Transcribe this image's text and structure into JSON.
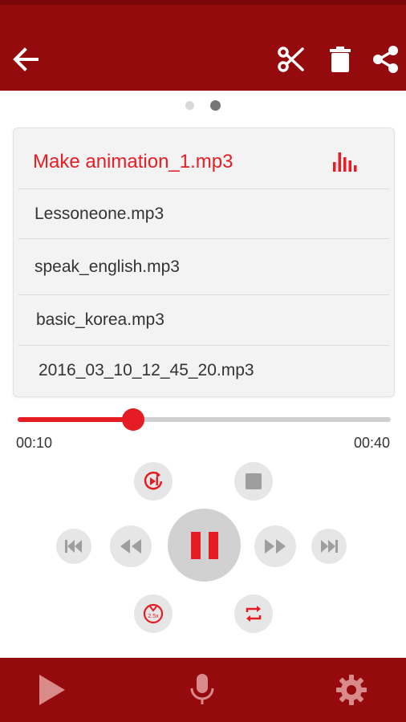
{
  "toolbar": {
    "icons": [
      "back-arrow-icon",
      "scissors-icon",
      "trash-icon",
      "share-icon"
    ]
  },
  "pager": {
    "pages": 2,
    "active_index": 1
  },
  "playlist": {
    "current": "Make animation_1.mp3",
    "items": [
      "Lessoneone.mp3",
      "speak_english.mp3",
      "basic_korea.mp3",
      "2016_03_10_12_45_20.mp3"
    ]
  },
  "player": {
    "elapsed": "00:10",
    "total": "00:40",
    "progress": 0.31,
    "speed_label": "2.5x"
  },
  "bottom_nav": {
    "items": [
      "play-tab-icon",
      "microphone-icon",
      "settings-gear-icon"
    ]
  },
  "colors": {
    "bar": "#950a0d",
    "accent": "#e51c23",
    "control_bg": "#e6e6e6",
    "control_icon": "#9e9e9e"
  }
}
